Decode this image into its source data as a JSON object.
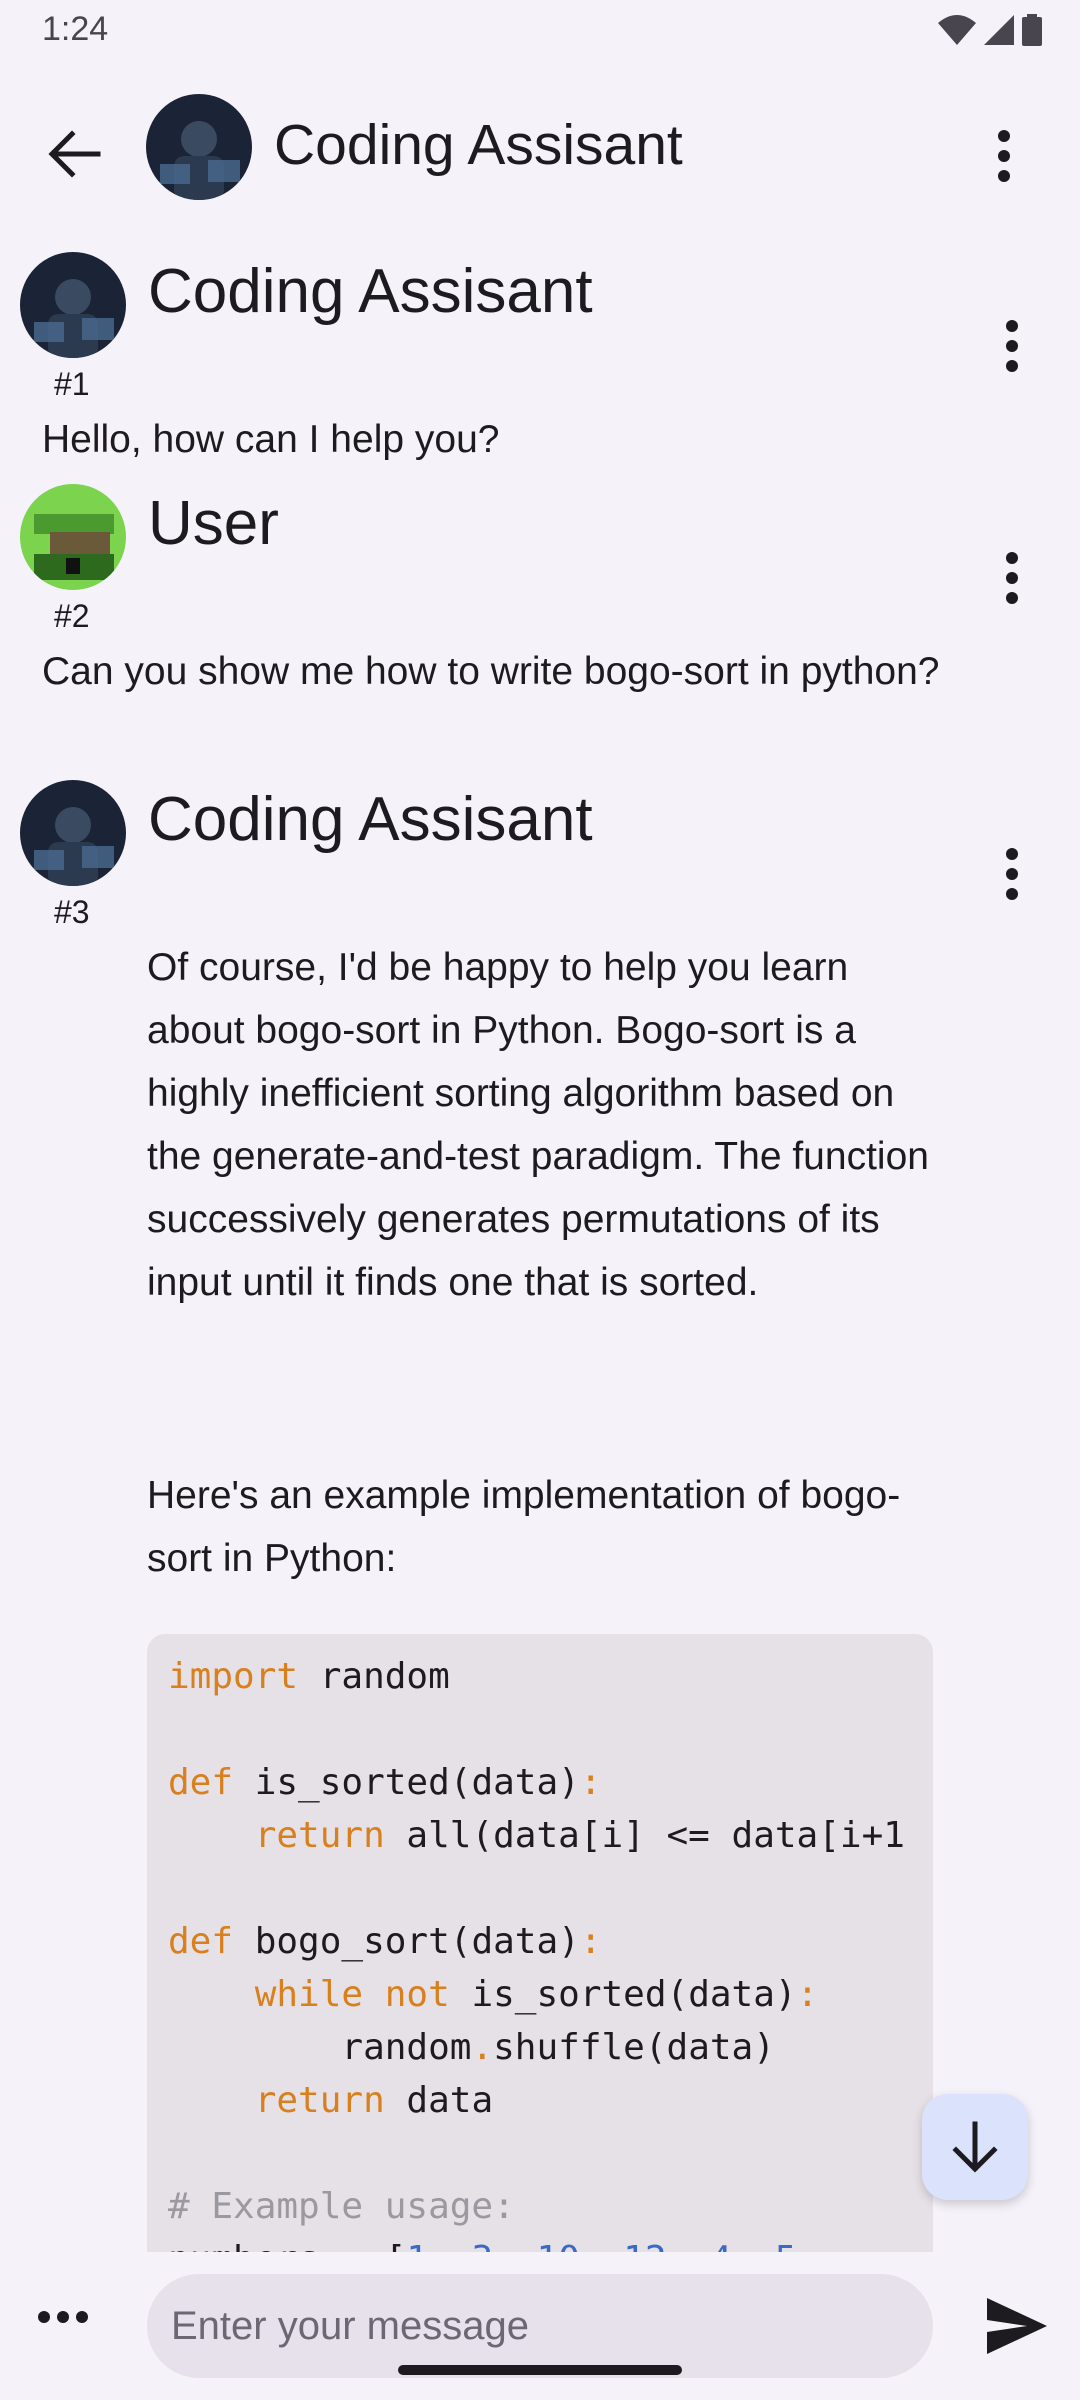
{
  "status_bar": {
    "time": "1:24"
  },
  "app_bar": {
    "title": "Coding Assisant"
  },
  "messages": [
    {
      "sender": "Coding Assisant",
      "number": "#1",
      "text": "Hello, how can I help you?"
    },
    {
      "sender": "User",
      "number": "#2",
      "text": "Can you show me how to write bogo-sort in python?"
    },
    {
      "sender": "Coding Assisant",
      "number": "#3",
      "paragraph1": "Of course, I'd be happy to help you learn about bogo-sort in Python. Bogo-sort is a highly inefficient sorting algorithm based on the generate-and-test paradigm. The function successively generates permutations of its input until it finds one that is sorted.",
      "paragraph2": "Here's an example implementation of bogo-sort in Python:",
      "code_lines": [
        "import random",
        "",
        "def is_sorted(data):",
        "    return all(data[i] <= data[i+1",
        "",
        "def bogo_sort(data):",
        "    while not is_sorted(data):",
        "        random.shuffle(data)",
        "    return data",
        "",
        "# Example usage:",
        "numbers = [1, 3, 10, 12, 4, 5"
      ]
    }
  ],
  "composer": {
    "placeholder": "Enter your message"
  },
  "colors": {
    "background": "#f5f2f9",
    "code_keyword": "#d8801e",
    "code_background": "#e6e1e7",
    "fab": "#dbe2fb"
  },
  "icons": {
    "back": "arrow-left-icon",
    "menu": "more-vert-icon",
    "scroll_down": "arrow-down-icon",
    "more": "more-horiz-icon",
    "send": "send-icon"
  }
}
